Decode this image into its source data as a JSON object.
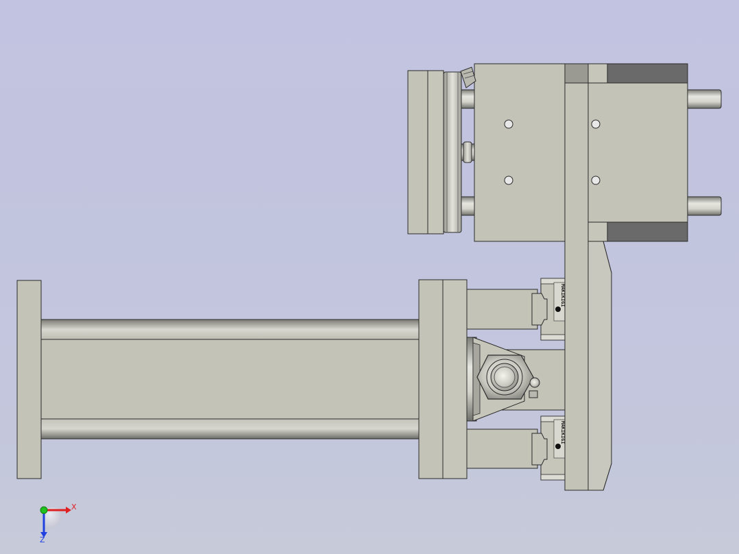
{
  "viewport": {
    "background_top": "#c2c3e0",
    "background_bottom": "#c6cad9"
  },
  "palette": {
    "part_fill": "#c3c3b8",
    "part_fill_light": "#cbcbc1",
    "part_dark": "#6a6a6a",
    "edge": "#2a2a2a",
    "rod_dark": "#8a8a84",
    "rod_light": "#e4e4de"
  },
  "triad": {
    "x_label": "X",
    "z_label": "Z",
    "x_color": "#e02020",
    "y_color": "#20c020",
    "z_color": "#2040e0"
  },
  "slides": {
    "stamp_text": "MAKIKIGI"
  }
}
